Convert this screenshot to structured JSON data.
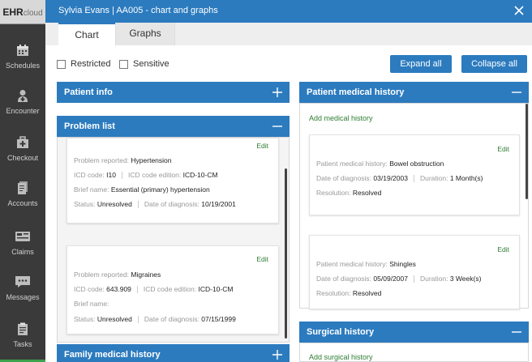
{
  "nav": {
    "logo": {
      "left": "EHR",
      "right": "cloud"
    },
    "items": [
      {
        "label": "Schedules",
        "icon": "calendar-icon"
      },
      {
        "label": "Encounter",
        "icon": "doctor-icon"
      },
      {
        "label": "Checkout",
        "icon": "medical-bag-icon"
      },
      {
        "label": "Accounts",
        "icon": "document-icon"
      },
      {
        "label": "Claims",
        "icon": "card-icon"
      },
      {
        "label": "Messages",
        "icon": "chat-icon"
      },
      {
        "label": "Tasks",
        "icon": "clipboard-icon"
      }
    ]
  },
  "window": {
    "title": "Sylvia Evans | AA005 - chart and graphs"
  },
  "tabs": [
    {
      "label": "Chart",
      "active": true
    },
    {
      "label": "Graphs",
      "active": false
    }
  ],
  "filters": {
    "restricted": "Restricted",
    "sensitive": "Sensitive"
  },
  "buttons": {
    "expand_all": "Expand all",
    "collapse_all": "Collapse all"
  },
  "panels": {
    "patient_info": {
      "title": "Patient info"
    },
    "problem_list": {
      "title": "Problem list",
      "labels": {
        "problem": "Problem reported:",
        "icd": "ICD code:",
        "edition": "ICD code edition:",
        "brief": "Brief name:",
        "status": "Status:",
        "dod": "Date of diagnosis:",
        "edit": "Edit"
      },
      "items": [
        {
          "problem": "Hypertension",
          "icd": "I10",
          "edition": "ICD-10-CM",
          "brief": "Essential (primary) hypertension",
          "status": "Unresolved",
          "dod": "10/19/2001"
        },
        {
          "problem": "Migraines",
          "icd": "643.909",
          "edition": "ICD-10-CM",
          "brief": "",
          "status": "Unresolved",
          "dod": "07/15/1999"
        }
      ]
    },
    "family_history": {
      "title": "Family medical history"
    },
    "medical_history": {
      "title": "Patient medical history",
      "add_label": "Add medical history",
      "labels": {
        "history": "Patient medical history:",
        "dod": "Date of diagnosis:",
        "duration": "Duration:",
        "resolution": "Resolution:",
        "edit": "Edit"
      },
      "items": [
        {
          "history": "Bowel obstruction",
          "dod": "03/19/2003",
          "duration": "1 Month(s)",
          "resolution": "Resolved"
        },
        {
          "history": "Shingles",
          "dod": "05/09/2007",
          "duration": "3 Week(s)",
          "resolution": "Resolved"
        }
      ]
    },
    "surgical_history": {
      "title": "Surgical history",
      "add_label": "Add surgical history"
    }
  },
  "colors": {
    "primary": "#2c7bbf",
    "nav_bg": "#3a3a3a",
    "link_green": "#2e7d32"
  }
}
